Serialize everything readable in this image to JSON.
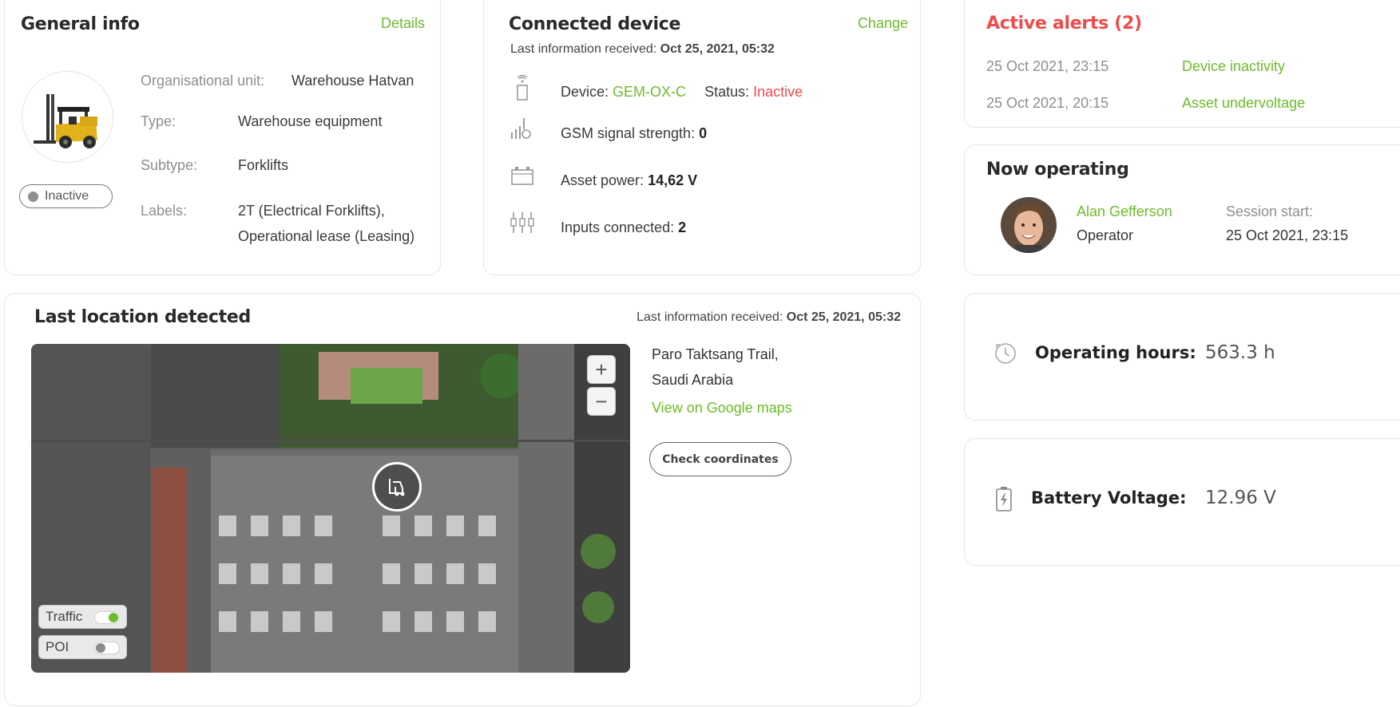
{
  "general_info": {
    "title": "General info",
    "details_link": "Details",
    "status": "Inactive",
    "fields": [
      {
        "label": "Organisational unit:",
        "value": "Warehouse Hatvan"
      },
      {
        "label": "Type:",
        "value": "Warehouse equipment"
      },
      {
        "label": "Subtype:",
        "value": "Forklifts"
      },
      {
        "label": "Labels:",
        "value": "2T (Electrical Forklifts),",
        "value2": "Operational lease (Leasing)"
      }
    ]
  },
  "connected_device": {
    "title": "Connected device",
    "change_link": "Change",
    "last_info_label": "Last information received:",
    "last_info_value": "Oct 25, 2021, 05:32",
    "device_label": "Device:",
    "device_value": "GEM-OX-C",
    "status_label": "Status:",
    "status_value": "Inactive",
    "gsm_label": "GSM signal strength:",
    "gsm_value": "0",
    "power_label": "Asset power:",
    "power_value": "14,62 V",
    "inputs_label": "Inputs connected:",
    "inputs_value": "2"
  },
  "active_alerts": {
    "title": "Active alerts (2)",
    "items": [
      {
        "time": "25 Oct  2021, 23:15",
        "name": "Device inactivity"
      },
      {
        "time": "25 Oct  2021, 20:15",
        "name": "Asset undervoltage"
      }
    ]
  },
  "now_operating": {
    "title": "Now operating",
    "operator_name": "Alan Gefferson",
    "operator_role": "Operator",
    "session_label": "Session start:",
    "session_value": "25 Oct  2021, 23:15"
  },
  "operating_hours": {
    "label": "Operating hours:",
    "value": "563.3 h"
  },
  "battery": {
    "label": "Battery Voltage:",
    "value": "12.96 V"
  },
  "location": {
    "title": "Last location detected",
    "last_info_label": "Last information received:",
    "last_info_value": "Oct 25, 2021, 05:32",
    "address_line1": "Paro Taktsang Trail,",
    "address_line2": "Saudi Arabia",
    "google_maps_link": "View on Google maps",
    "check_coordinates": "Check coordinates",
    "zoom_in": "+",
    "zoom_out": "−",
    "traffic_label": "Traffic",
    "traffic_on": true,
    "poi_label": "POI",
    "poi_on": false
  },
  "colors": {
    "accent": "#6dbb2b",
    "alert": "#ef4b4b"
  }
}
